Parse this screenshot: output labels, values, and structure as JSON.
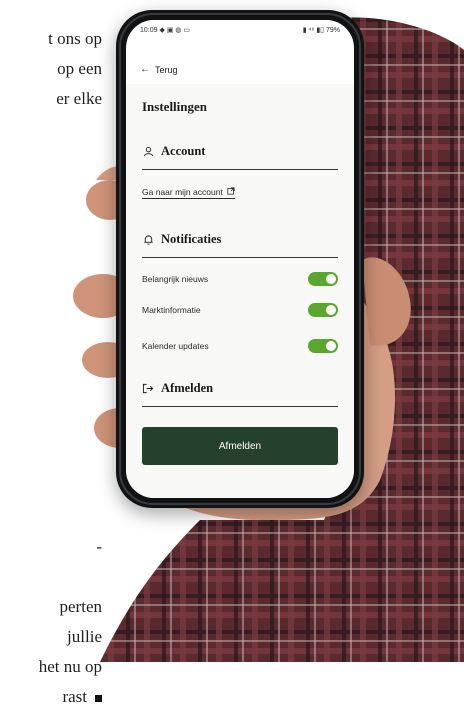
{
  "article": {
    "top_lines": [
      "t ons op",
      "op een",
      "er elke"
    ],
    "bottom_lines": [
      "-",
      "",
      "perten",
      "jullie",
      "het nu op",
      "rast"
    ]
  },
  "status_bar": {
    "time": "10:09",
    "left_icons": "◆ ▣ ◍ ▭",
    "right": "▮ ⁴⁶ ▮▯ 79%"
  },
  "nav": {
    "back_label": "Terug"
  },
  "page": {
    "title": "Instellingen"
  },
  "account": {
    "heading": "Account",
    "link_label": "Ga naar mijn account"
  },
  "notifications": {
    "heading": "Notificaties",
    "items": [
      {
        "label": "Belangrijk nieuws",
        "enabled": true
      },
      {
        "label": "Marktinformatie",
        "enabled": true
      },
      {
        "label": "Kalender updates",
        "enabled": true
      }
    ]
  },
  "logout": {
    "heading": "Afmelden",
    "button_label": "Afmelden"
  },
  "colors": {
    "toggle_on": "#5aa62f",
    "primary_button": "#25412b"
  }
}
